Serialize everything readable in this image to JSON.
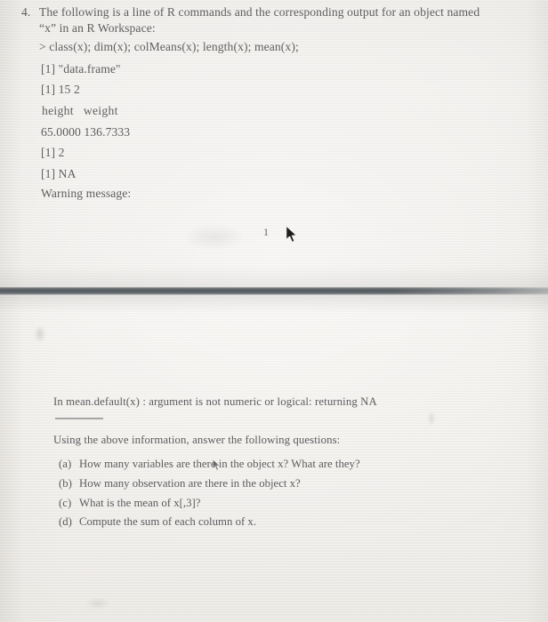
{
  "document": {
    "type": "scanned-exam-question",
    "question_number": "4.",
    "intro": {
      "line1": "The following is a line of R commands and the corresponding output for an object named",
      "line2": "“x” in an R Workspace:"
    },
    "console": {
      "command": "> class(x); dim(x); colMeans(x); length(x); mean(x);",
      "output_lines": [
        "[1] \"data.frame\"",
        "[1] 15 2",
        "height   weight",
        "65.0000 136.7333",
        "[1] 2",
        "[1] NA",
        "Warning message:"
      ],
      "warning_continuation": "In mean.default(x) : argument is not numeric or logical: returning NA"
    },
    "stray_mark": "1",
    "prompt": "Using the above information, answer the following questions:",
    "sub_questions": [
      {
        "label": "(a)",
        "text": "How many variables are there in the object x? What are they?"
      },
      {
        "label": "(b)",
        "text": "How many observation are there in the object x?"
      },
      {
        "label": "(c)",
        "text": "What is the mean of x[,3]?"
      },
      {
        "label": "(d)",
        "text": "Compute the sum of each column of x."
      }
    ],
    "artifacts": {
      "page_edge_band": "dark horizontal scan shadow",
      "short_rule": "short horizontal pencil rule"
    },
    "colors": {
      "paper": "#f2f0ed",
      "ink": "#5d5d5e",
      "edge_band": "#5f6569"
    }
  }
}
